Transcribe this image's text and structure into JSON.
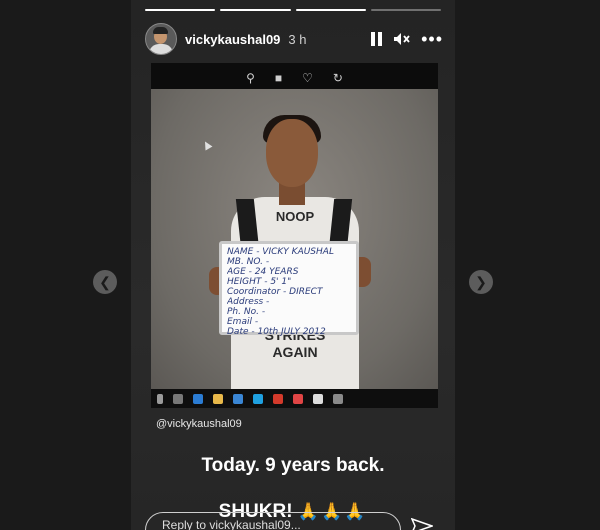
{
  "story": {
    "username": "vickykaushal09",
    "time_ago": "3 h",
    "progress_segments": [
      1,
      1,
      1,
      0.6
    ],
    "mention": "@vickykaushal09",
    "caption_line1": "Today. 9 years back.",
    "caption_line2": "SHUKR!",
    "caption_emoji": "🙏🙏🙏",
    "reply_placeholder": "Reply to vickykaushal09..."
  },
  "photo": {
    "shirt_text_top": "NOOP",
    "shirt_text_bottom": "STRIKES\nAGAIN",
    "board_lines": [
      "NAME - VICKY KAUSHAL",
      "MB. NO. -",
      "AGE - 24 YEARS",
      "HEIGHT - 5' 1\"",
      "Coordinator - DIRECT",
      "Address -",
      "Ph. No. -",
      "Email -",
      "Date - 10th JULY 2012"
    ]
  },
  "icons": {
    "pause": "pause-icon",
    "mute": "mute-icon",
    "more": "more-icon",
    "send": "send-icon",
    "prev": "chevron-left-icon",
    "next": "chevron-right-icon"
  },
  "colors": {
    "background": "#1a1a1a",
    "story_bg": "#262626",
    "text": "#ffffff"
  }
}
